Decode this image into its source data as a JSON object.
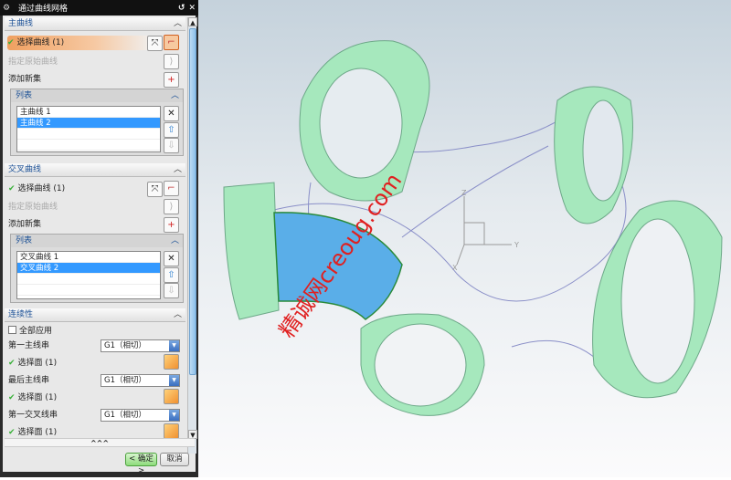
{
  "dialog": {
    "title": "通过曲线网格",
    "reset_icon": "reset-icon",
    "close_icon": "close-icon"
  },
  "primary": {
    "header": "主曲线",
    "select_label": "选择曲线 (1)",
    "specify_label": "指定原始曲线",
    "add_set_label": "添加新集",
    "list_header": "列表",
    "items": [
      "主曲线 1",
      "主曲线 2"
    ],
    "selected_index": 1
  },
  "cross": {
    "header": "交叉曲线",
    "select_label": "选择曲线 (1)",
    "specify_label": "指定原始曲线",
    "add_set_label": "添加新集",
    "list_header": "列表",
    "items": [
      "交叉曲线 1",
      "交叉曲线 2"
    ],
    "selected_index": 1
  },
  "continuity": {
    "header": "连续性",
    "apply_all_label": "全部应用",
    "apply_all_checked": false,
    "rows": [
      {
        "label": "第一主线串",
        "value": "G1（相切）",
        "face": "选择面 (1)"
      },
      {
        "label": "最后主线串",
        "value": "G1（相切）",
        "face": "选择面 (1)"
      },
      {
        "label": "第一交叉线串",
        "value": "G1（相切）",
        "face": "选择面 (1)"
      }
    ]
  },
  "more_label": "^^^",
  "ok_label": "< 确定 >",
  "cancel_label": "取消",
  "viewport": {
    "watermark": "精诚网creoug.com",
    "axes": {
      "x": "X",
      "y": "Y",
      "z": "Z"
    },
    "colors": {
      "ring": "#9fe4b4",
      "surface": "#5aaee8",
      "watermark": "#e02020"
    }
  }
}
